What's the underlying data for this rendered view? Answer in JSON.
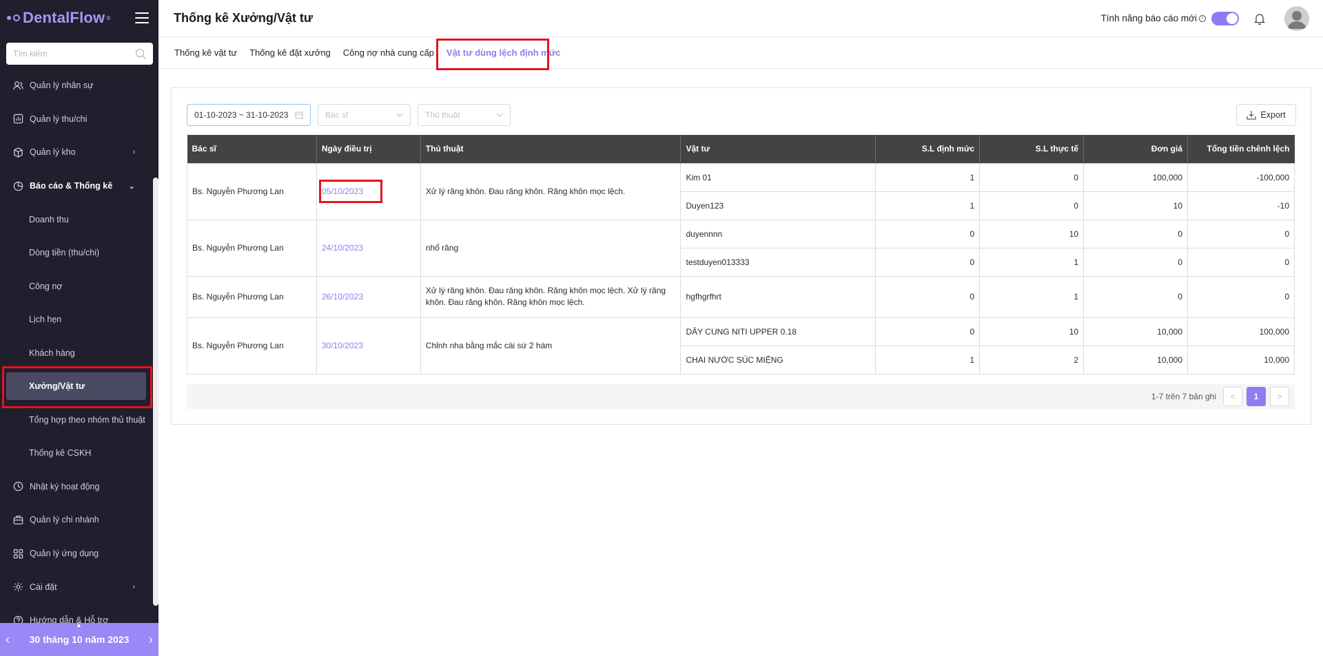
{
  "app": {
    "logo": "DentalFlow",
    "logo_mark": "®"
  },
  "header": {
    "title": "Thống kê Xưởng/Vật tư",
    "feature_label": "Tính năng báo cáo mới",
    "feature_toggle_on": true
  },
  "search": {
    "placeholder": "Tìm kiếm"
  },
  "sidebar": {
    "items": [
      {
        "label": "Quản lý nhân sự",
        "icon": "users-icon"
      },
      {
        "label": "Quản lý thu/chi",
        "icon": "chart-bar-icon"
      },
      {
        "label": "Quản lý kho",
        "icon": "box-icon",
        "caret": "›"
      },
      {
        "label": "Báo cáo & Thống kê",
        "icon": "pie-chart-icon",
        "caret": "⌄"
      },
      {
        "label": "Doanh thu"
      },
      {
        "label": "Dòng tiền (thu/chi)"
      },
      {
        "label": "Công nợ"
      },
      {
        "label": "Lịch hẹn"
      },
      {
        "label": "Khách hàng"
      },
      {
        "label": "Xưởng/Vật tư"
      },
      {
        "label": "Tổng hợp theo nhóm thủ thuật"
      },
      {
        "label": "Thống kê CSKH"
      },
      {
        "label": "Nhật ký hoạt động",
        "icon": "history-icon"
      },
      {
        "label": "Quản lý chi nhánh",
        "icon": "branch-icon"
      },
      {
        "label": "Quản lý ứng dụng",
        "icon": "apps-icon"
      },
      {
        "label": "Cài đặt",
        "icon": "gear-icon",
        "caret": "›"
      },
      {
        "label": "Hướng dẫn & Hỗ trợ",
        "icon": "help-icon"
      }
    ]
  },
  "date_bar": {
    "label": "30 tháng 10 năm 2023",
    "prev": "‹",
    "next": "›",
    "up": "▲"
  },
  "tabs": [
    {
      "label": "Thống kê vật tư"
    },
    {
      "label": "Thống kê đặt xưởng"
    },
    {
      "label": "Công nợ nhà cung cấp"
    },
    {
      "label": "Vật tư dùng lệch định mức"
    }
  ],
  "filters": {
    "date_range": "01-10-2023  ~  31-10-2023",
    "doctor_placeholder": "Bác sĩ",
    "procedure_placeholder": "Thủ thuật",
    "export_label": "Export"
  },
  "table": {
    "headers": [
      "Bác sĩ",
      "Ngày điều trị",
      "Thủ thuật",
      "Vật tư",
      "S.L định mức",
      "S.L thực tế",
      "Đơn giá",
      "Tổng tiền chênh lệch"
    ],
    "groups": [
      {
        "doctor": "Bs. Nguyễn Phương Lan",
        "date": "05/10/2023",
        "procedure": "Xử lý răng khôn. Đau răng khôn. Răng khôn mọc lệch.",
        "items": [
          {
            "material": "Kim 01",
            "norm": "1",
            "actual": "0",
            "price": "100,000",
            "diff": "-100,000"
          },
          {
            "material": "Duyen123",
            "norm": "1",
            "actual": "0",
            "price": "10",
            "diff": "-10"
          }
        ]
      },
      {
        "doctor": "Bs. Nguyễn Phương Lan",
        "date": "24/10/2023",
        "procedure": "nhổ răng",
        "items": [
          {
            "material": "duyennnn",
            "norm": "0",
            "actual": "10",
            "price": "0",
            "diff": "0"
          },
          {
            "material": "testduyen013333",
            "norm": "0",
            "actual": "1",
            "price": "0",
            "diff": "0"
          }
        ]
      },
      {
        "doctor": "Bs. Nguyễn Phương Lan",
        "date": "26/10/2023",
        "procedure": "Xử lý răng khôn. Đau răng khôn. Răng khôn mọc lệch. Xử lý răng khôn. Đau răng khôn. Răng khôn mọc lệch.",
        "items": [
          {
            "material": "hgfhgrfhrt",
            "norm": "0",
            "actual": "1",
            "price": "0",
            "diff": "0"
          }
        ]
      },
      {
        "doctor": "Bs. Nguyễn Phương Lan",
        "date": "30/10/2023",
        "procedure": "Chỉnh nha bằng mắc cài sứ 2 hàm",
        "items": [
          {
            "material": "DÂY CUNG NITI UPPER 0.18",
            "norm": "0",
            "actual": "10",
            "price": "10,000",
            "diff": "100,000"
          },
          {
            "material": "CHAI NƯỚC SÚC MIỆNG",
            "norm": "1",
            "actual": "2",
            "price": "10,000",
            "diff": "10,000"
          }
        ]
      }
    ]
  },
  "pagination": {
    "summary": "1-7 trên 7 bản ghi",
    "prev": "<",
    "current": "1",
    "next": ">"
  },
  "colors": {
    "accent": "#8f7cf2",
    "sidebar_bg": "#1f1f2e",
    "highlight": "#e4141e",
    "table_header": "#434343"
  }
}
